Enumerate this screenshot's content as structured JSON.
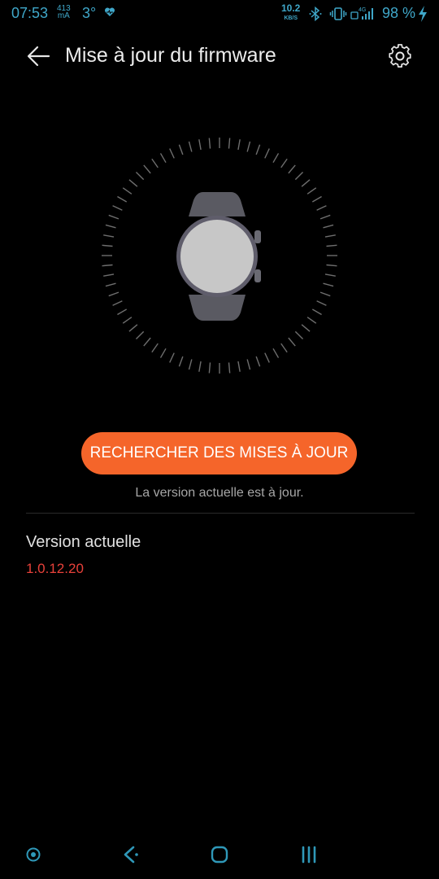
{
  "status_bar": {
    "time": "07:53",
    "current_value": "413",
    "current_unit": "mA",
    "temperature": "3°",
    "net_speed_value": "10.2",
    "net_speed_unit": "KB/S",
    "network_type": "4G",
    "battery_percent": "98 %",
    "color": "#3fa7c9"
  },
  "header": {
    "title": "Mise à jour du firmware",
    "back_icon": "arrow-left-icon",
    "settings_icon": "gear-icon"
  },
  "illustration": {
    "icon": "smartwatch-icon"
  },
  "main": {
    "check_button_label": "RECHERCHER DES MISES À JOUR",
    "status_message": "La version actuelle est à jour.",
    "version_label": "Version actuelle",
    "version_value": "1.0.12.20"
  },
  "nav_bar": {
    "items": [
      "screen-record-icon",
      "back-icon",
      "home-icon",
      "recents-icon"
    ]
  },
  "colors": {
    "accent": "#f5652a",
    "version": "#e8413a",
    "background": "#000000"
  }
}
